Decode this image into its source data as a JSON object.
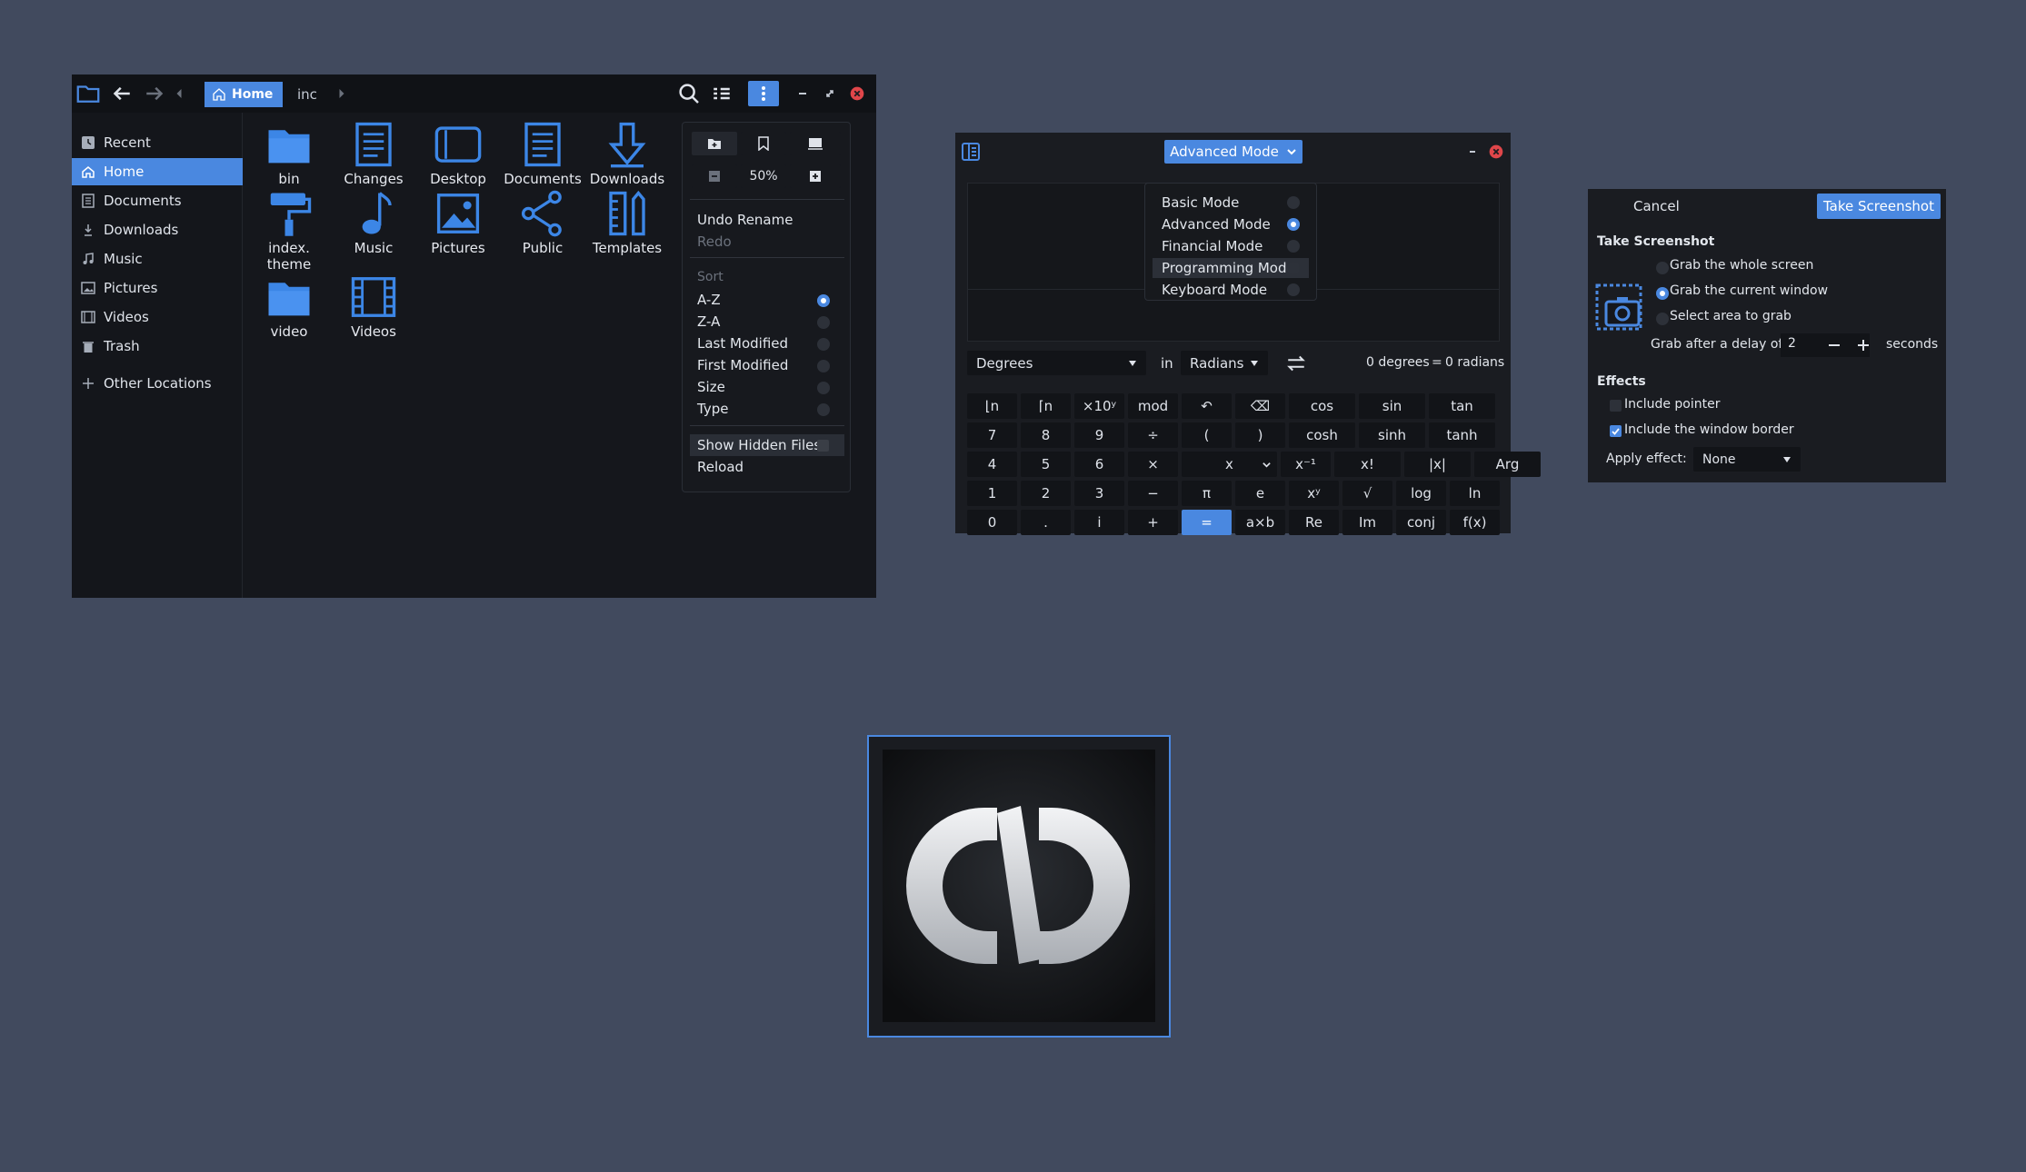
{
  "file_manager": {
    "breadcrumb": [
      "Home",
      "inc"
    ],
    "sidebar": [
      {
        "label": "Recent",
        "icon": "clock-icon"
      },
      {
        "label": "Home",
        "icon": "home-icon",
        "active": true
      },
      {
        "label": "Documents",
        "icon": "document-icon"
      },
      {
        "label": "Downloads",
        "icon": "download-icon"
      },
      {
        "label": "Music",
        "icon": "music-icon"
      },
      {
        "label": "Pictures",
        "icon": "picture-icon"
      },
      {
        "label": "Videos",
        "icon": "film-icon"
      },
      {
        "label": "Trash",
        "icon": "trash-icon"
      },
      {
        "label": "Other Locations",
        "icon": "plus-icon"
      }
    ],
    "files": [
      {
        "name": "bin",
        "icon": "folder-icon"
      },
      {
        "name": "Changes",
        "icon": "document-icon"
      },
      {
        "name": "Desktop",
        "icon": "desktop-icon"
      },
      {
        "name": "Documents",
        "icon": "document-icon"
      },
      {
        "name": "Downloads",
        "icon": "download-icon"
      },
      {
        "name": "index.\ntheme",
        "icon": "paint-roller-icon"
      },
      {
        "name": "Music",
        "icon": "music-icon"
      },
      {
        "name": "Pictures",
        "icon": "picture-icon"
      },
      {
        "name": "Public",
        "icon": "share-icon"
      },
      {
        "name": "Templates",
        "icon": "templates-icon"
      },
      {
        "name": "video",
        "icon": "folder-icon"
      },
      {
        "name": "Videos",
        "icon": "film-icon"
      }
    ],
    "menu": {
      "zoom": "50%",
      "undo": "Undo Rename",
      "redo": "Redo",
      "sort_header": "Sort",
      "sort_options": [
        {
          "label": "A-Z",
          "selected": true
        },
        {
          "label": "Z-A",
          "selected": false
        },
        {
          "label": "Last Modified",
          "selected": false
        },
        {
          "label": "First Modified",
          "selected": false
        },
        {
          "label": "Size",
          "selected": false
        },
        {
          "label": "Type",
          "selected": false
        }
      ],
      "show_hidden": "Show Hidden Files",
      "reload": "Reload"
    }
  },
  "calculator": {
    "mode_button": "Advanced Mode",
    "modes": [
      {
        "label": "Basic Mode",
        "selected": false
      },
      {
        "label": "Advanced Mode",
        "selected": true
      },
      {
        "label": "Financial Mode",
        "selected": false
      },
      {
        "label": "Programming Mode",
        "selected": false
      },
      {
        "label": "Keyboard Mode",
        "selected": false
      }
    ],
    "conv_from": "Degrees",
    "conv_in": "in",
    "conv_to": "Radians",
    "conv_result_left": "0 degrees",
    "conv_eq": "=",
    "conv_result_right": "0 radians",
    "keys": [
      [
        "⌊n",
        "⌈n",
        "×10ʸ",
        "mod",
        "↶",
        "⌫",
        "cos",
        "sin",
        "tan"
      ],
      [
        "7",
        "8",
        "9",
        "÷",
        "(",
        ")",
        "cosh",
        "sinh",
        "tanh"
      ],
      [
        "4",
        "5",
        "6",
        "×",
        "x",
        "x⁻¹",
        "x!",
        "|x|",
        "Arg"
      ],
      [
        "1",
        "2",
        "3",
        "−",
        "π",
        "e",
        "xʸ",
        "√",
        "log",
        "ln"
      ],
      [
        "0",
        ".",
        "i",
        "+",
        "=",
        "a×b",
        "Re",
        "Im",
        "conj",
        "f(x)"
      ]
    ]
  },
  "screenshot": {
    "cancel": "Cancel",
    "take": "Take Screenshot",
    "section_take": "Take Screenshot",
    "options": [
      {
        "label": "Grab the whole screen",
        "selected": false
      },
      {
        "label": "Grab the current window",
        "selected": true
      },
      {
        "label": "Select area to grab",
        "selected": false
      }
    ],
    "delay_label": "Grab after a delay of",
    "delay_value": "2",
    "delay_unit": "seconds",
    "effects_header": "Effects",
    "include_pointer": "Include pointer",
    "include_border": "Include the window border",
    "apply_effect_label": "Apply effect:",
    "apply_effect_value": "None"
  },
  "colors": {
    "accent": "#4a88e0",
    "desktop": "#414a5e",
    "window": "#15171c"
  }
}
